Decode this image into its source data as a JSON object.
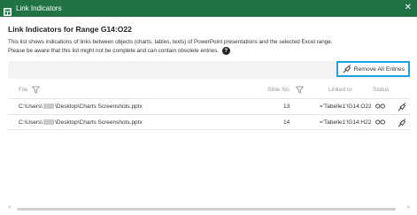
{
  "window": {
    "title": "Link Indicators",
    "close_glyph": "✕"
  },
  "heading": "Link Indicators for Range G14:O22",
  "description": {
    "line1": "This list shows indications of links between objects (charts, tables, texts) of PowerPoint presentations and the selected Excel range.",
    "line2": "Please be aware that this list might not be complete and can contain obsolete entries."
  },
  "toolbar": {
    "remove_all_label": "Remove All Entries"
  },
  "columns": {
    "file": "File",
    "slide_no": "Slide No.",
    "linked_to": "Linked to",
    "status": "Status"
  },
  "rows": [
    {
      "file_prefix": "C:\\Users\\",
      "file_suffix": "\\Desktop\\Charts Screenshots.pptx",
      "slide": "13",
      "linked_to": "='Tabelle1'!G14:O22"
    },
    {
      "file_prefix": "C:\\Users\\",
      "file_suffix": "\\Desktop\\Charts Screenshots.pptx",
      "slide": "14",
      "linked_to": "='Tabelle1'!G14:H22"
    }
  ],
  "scrollbar": {
    "left_arrow": "<",
    "right_arrow": ">"
  },
  "colors": {
    "titlebar": "#217346",
    "button_border": "#1fa1e0",
    "toolbar_bg": "#f3f3f3"
  }
}
